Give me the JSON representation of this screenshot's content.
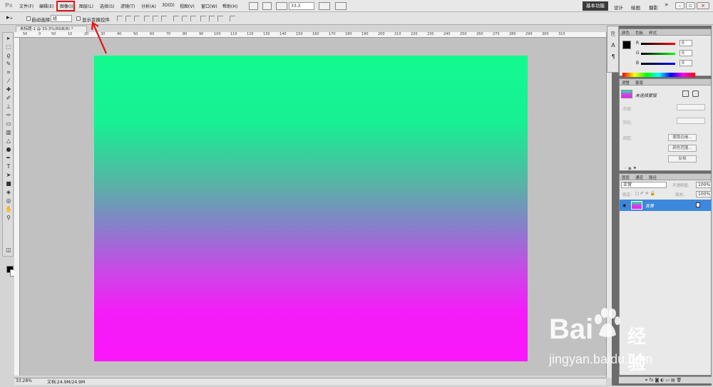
{
  "app": {
    "logo": "Ps"
  },
  "menu": {
    "items": [
      "文件(F)",
      "编辑(E)",
      "图像(I)",
      "图层(L)",
      "选择(S)",
      "滤镜(T)",
      "分析(A)",
      "3D(D)",
      "视图(V)",
      "窗口(W)",
      "帮助(H)"
    ],
    "highlighted": "图像(I)",
    "highlight_color": "#e01818"
  },
  "menubar": {
    "zoom": "33.3",
    "icons": [
      "bridge-icon",
      "minibridge-icon",
      "view-extras-icon",
      "zoom-level-icon",
      "arrange-docs-icon",
      "screen-mode-icon"
    ]
  },
  "workspace": {
    "active": "基本功能",
    "items": [
      "设计",
      "绘画",
      "摄影"
    ],
    "more": "»"
  },
  "options": {
    "auto_select_label": "自动选择:",
    "group_value": "组",
    "show_transform_label": "显示变换控件"
  },
  "document": {
    "tab_title": "未标题-1 @ 33.3%(RGB/8) *",
    "zoom_status": "33.28%",
    "doc_size": "文档:24.9M/24.9M"
  },
  "ruler": {
    "top_labels": [
      "50",
      "0",
      "50",
      "10",
      "20",
      "30",
      "40",
      "50",
      "60",
      "70",
      "80",
      "90",
      "100",
      "110",
      "120",
      "130",
      "140",
      "150",
      "160",
      "170",
      "180",
      "190",
      "200",
      "210",
      "220",
      "230",
      "240",
      "250",
      "260",
      "270",
      "280",
      "290",
      "300",
      "310"
    ]
  },
  "canvas": {
    "gradient_colors": [
      "#13fa90",
      "#16f093",
      "#57b3a6",
      "#9076d0",
      "#c84ae6",
      "#f41cf8",
      "#fb16fb"
    ]
  },
  "color_panel": {
    "tabs": [
      "颜色",
      "色板",
      "样式"
    ],
    "channels": [
      {
        "label": "R",
        "value": "0"
      },
      {
        "label": "G",
        "value": "0"
      },
      {
        "label": "B",
        "value": "0"
      }
    ]
  },
  "adjust_panel": {
    "tabs": [
      "调整",
      "蒙版"
    ],
    "no_selection": "未选择蒙版",
    "labels": [
      "浓度:",
      "羽化:",
      "调整:"
    ],
    "buttons": [
      "蒙版边缘...",
      "颜色范围...",
      "反相"
    ]
  },
  "layers_panel": {
    "tabs": [
      "图层",
      "通道",
      "路径"
    ],
    "blend_mode": "正常",
    "opacity_label": "不透明度:",
    "opacity": "100%",
    "lock_label": "锁定:",
    "fill_label": "填充:",
    "fill": "100%",
    "layer": {
      "name": "背景"
    }
  },
  "watermark": {
    "bai": "Bai",
    "jy": "经验",
    "url": "jingyan.baidu.com"
  }
}
